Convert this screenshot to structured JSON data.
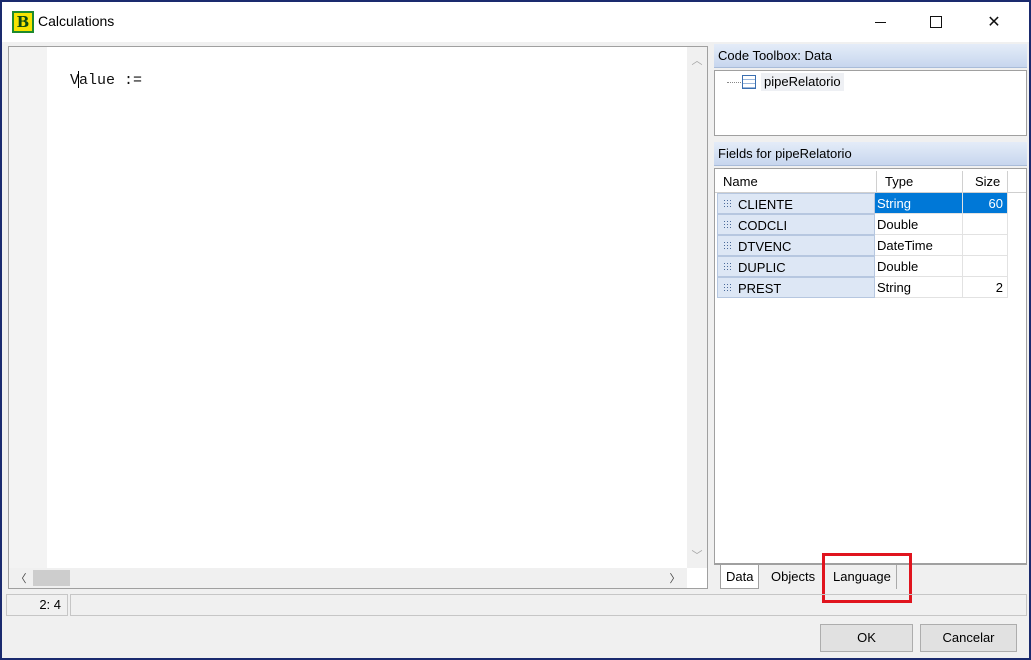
{
  "window": {
    "title": "Calculations",
    "app_icon_letter": "B",
    "controls": {
      "minimize": "minimize-icon",
      "maximize": "maximize-icon",
      "close": "close-icon"
    }
  },
  "editor": {
    "code": "Value :="
  },
  "toolbox": {
    "header": "Code Toolbox: Data",
    "tree_items": [
      {
        "label": "pipeRelatorio",
        "icon": "table-icon"
      }
    ]
  },
  "fields": {
    "header": "Fields for pipeRelatorio",
    "columns": {
      "name": "Name",
      "type": "Type",
      "size": "Size"
    },
    "rows": [
      {
        "name": "CLIENTE",
        "type": "String",
        "size": "60",
        "selected": true
      },
      {
        "name": "CODCLI",
        "type": "Double",
        "size": ""
      },
      {
        "name": "DTVENC",
        "type": "DateTime",
        "size": ""
      },
      {
        "name": "DUPLIC",
        "type": "Double",
        "size": ""
      },
      {
        "name": "PREST",
        "type": "String",
        "size": "2"
      }
    ]
  },
  "tabs": [
    {
      "label": "Data",
      "active": true
    },
    {
      "label": "Objects",
      "active": false
    },
    {
      "label": "Language",
      "active": false,
      "highlighted": true
    }
  ],
  "status": {
    "cursor_position": "2: 4"
  },
  "buttons": {
    "ok": "OK",
    "cancel": "Cancelar"
  },
  "colors": {
    "selection": "#0078d7",
    "highlight_box": "#e0141e",
    "panel_header": "#c7d6ee"
  }
}
